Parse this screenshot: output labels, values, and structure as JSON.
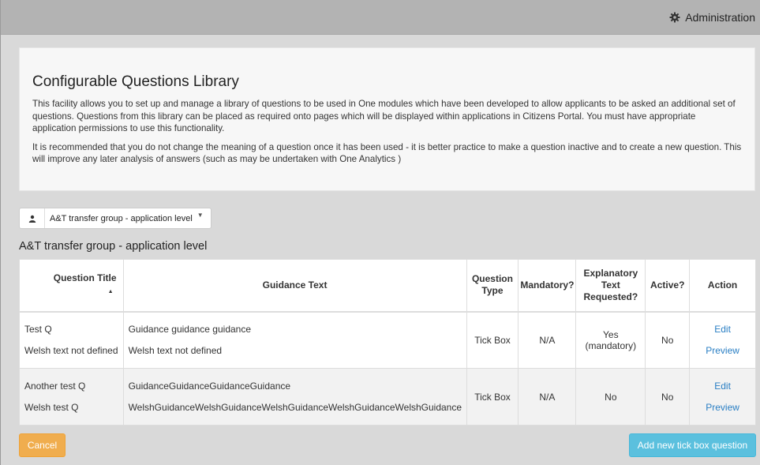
{
  "header": {
    "admin_label": "Administration",
    "admin_icon": "gear-icon"
  },
  "intro": {
    "title": "Configurable Questions Library",
    "paragraph1": "This facility allows you to set up and manage a library of questions to be used in One modules which have been developed to allow applicants to be asked an additional set of questions. Questions from this library can be placed as required onto pages which will be displayed within applications in Citizens Portal. You must have appropriate application permissions to use this functionality.",
    "paragraph2": "It is recommended that you do not change the meaning of a question once it has been used - it is better practice to make a question inactive and to create a new question. This will improve any later analysis of answers (such as may be undertaken with One Analytics )"
  },
  "group_selector": {
    "icon": "user-icon",
    "selected": "A&T transfer group - application level"
  },
  "section_title": "A&T transfer group - application level",
  "table": {
    "headers": {
      "question_title": "Question Title",
      "guidance_text": "Guidance Text",
      "question_type_1": "Question",
      "question_type_2": "Type",
      "mandatory": "Mandatory?",
      "explanatory_1": "Explanatory",
      "explanatory_2": "Text",
      "explanatory_3": "Requested?",
      "active": "Active?",
      "action": "Action"
    },
    "rows": [
      {
        "title": "Test Q",
        "welsh_title": "Welsh text not defined",
        "guidance": "Guidance guidance guidance",
        "welsh_guidance": "Welsh text not defined",
        "type": "Tick Box",
        "mandatory": "N/A",
        "explanatory_1": "Yes",
        "explanatory_2": "(mandatory)",
        "active": "No",
        "edit": "Edit",
        "preview": "Preview"
      },
      {
        "title": "Another test Q",
        "welsh_title": "Welsh test Q",
        "guidance": "GuidanceGuidanceGuidanceGuidance",
        "welsh_guidance": "WelshGuidanceWelshGuidanceWelshGuidanceWelshGuidanceWelshGuidance",
        "type": "Tick Box",
        "mandatory": "N/A",
        "explanatory_1": "No",
        "explanatory_2": "",
        "active": "No",
        "edit": "Edit",
        "preview": "Preview"
      }
    ]
  },
  "buttons": {
    "cancel": "Cancel",
    "add": "Add new tick box question"
  },
  "colors": {
    "cancel_bg": "#f0ad4e",
    "add_bg": "#5bc0de",
    "link": "#2a7fc4"
  }
}
